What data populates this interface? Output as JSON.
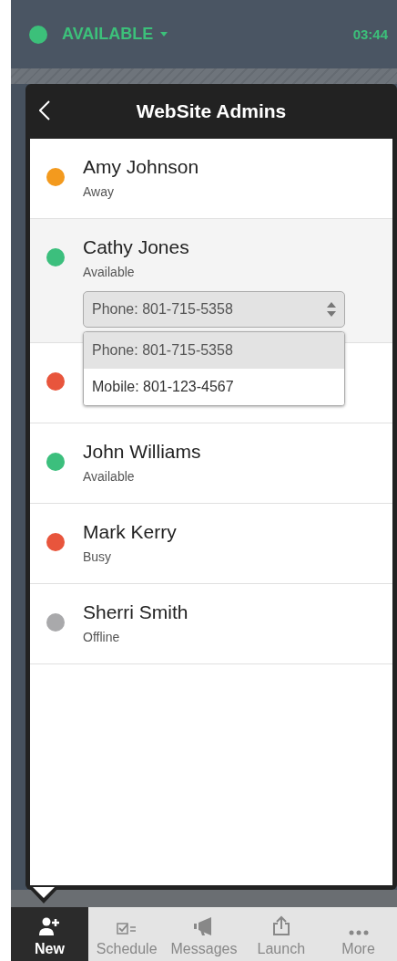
{
  "status": {
    "label": "AVAILABLE",
    "color": "#3cc07a",
    "time": "03:44"
  },
  "popup": {
    "title": "WebSite Admins"
  },
  "contacts": [
    {
      "name": "Amy Johnson",
      "status": "Away",
      "color": "#f39a1e",
      "expanded": false
    },
    {
      "name": "Cathy Jones",
      "status": "Available",
      "color": "#3cbf7d",
      "expanded": true,
      "select": {
        "value": "Phone: 801-715-5358",
        "options": [
          {
            "label": "Phone: 801-715-5358",
            "selected": true
          },
          {
            "label": "Mobile: 801-123-4567",
            "selected": false
          }
        ]
      }
    },
    {
      "color": "#e8553c",
      "expanded": false
    },
    {
      "name": "John Williams",
      "status": "Available",
      "color": "#3cbf7d",
      "expanded": false
    },
    {
      "name": "Mark Kerry",
      "status": "Busy",
      "color": "#e8553c",
      "expanded": false
    },
    {
      "name": "Sherri Smith",
      "status": "Offline",
      "color": "#a9a9ab",
      "expanded": false
    }
  ],
  "nav": [
    {
      "label": "New",
      "kind": "new",
      "selected": true
    },
    {
      "label": "Schedule",
      "kind": "schedule",
      "selected": false
    },
    {
      "label": "Messages",
      "kind": "messages",
      "selected": false
    },
    {
      "label": "Launch",
      "kind": "launch",
      "selected": false
    },
    {
      "label": "More",
      "kind": "more",
      "selected": false
    }
  ]
}
